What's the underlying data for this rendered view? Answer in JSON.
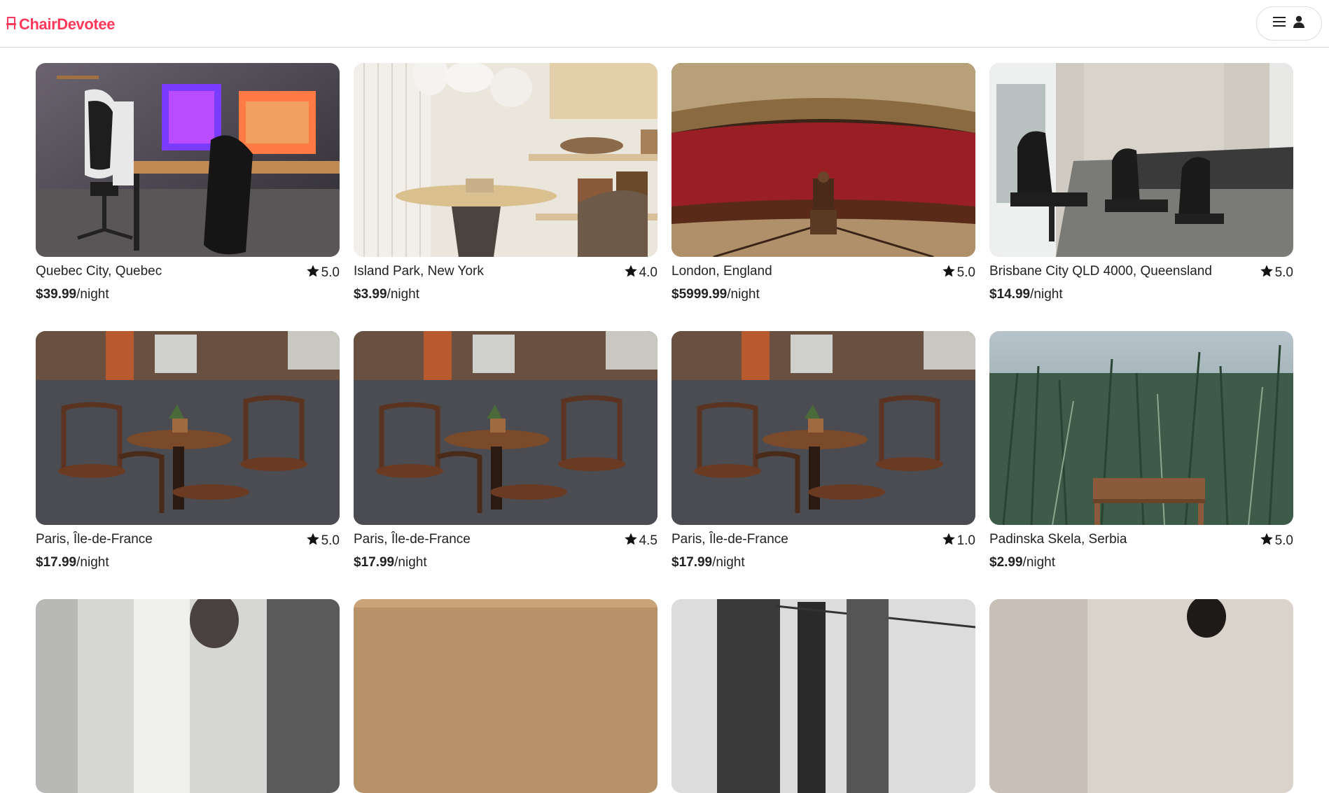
{
  "brand": {
    "name": "ChairDevotee",
    "color": "#ff385c",
    "icon": "chair-icon"
  },
  "header": {
    "menu_icon": "hamburger-icon",
    "user_icon": "user-icon"
  },
  "listings": [
    {
      "location": "Quebec City, Quebec",
      "rating": "5.0",
      "price": "$39.99",
      "unit": "/night",
      "image": "gaming-office-chair"
    },
    {
      "location": "Island Park, New York",
      "rating": "4.0",
      "price": "$3.99",
      "unit": "/night",
      "image": "round-table-room"
    },
    {
      "location": "London, England",
      "rating": "5.0",
      "price": "$5999.99",
      "unit": "/night",
      "image": "throne-hall"
    },
    {
      "location": "Brisbane City QLD 4000, Queensland",
      "rating": "5.0",
      "price": "$14.99",
      "unit": "/night",
      "image": "conference-chairs"
    },
    {
      "location": "Paris, Île-de-France",
      "rating": "5.0",
      "price": "$17.99",
      "unit": "/night",
      "image": "cafe-chairs"
    },
    {
      "location": "Paris, Île-de-France",
      "rating": "4.5",
      "price": "$17.99",
      "unit": "/night",
      "image": "cafe-chairs"
    },
    {
      "location": "Paris, Île-de-France",
      "rating": "1.0",
      "price": "$17.99",
      "unit": "/night",
      "image": "cafe-chairs"
    },
    {
      "location": "Padinska Skela, Serbia",
      "rating": "5.0",
      "price": "$2.99",
      "unit": "/night",
      "image": "chair-in-wheat-field"
    },
    {
      "location": "",
      "rating": "",
      "price": "",
      "unit": "",
      "image": "window-portrait"
    },
    {
      "location": "",
      "rating": "",
      "price": "",
      "unit": "",
      "image": "wood-wall"
    },
    {
      "location": "",
      "rating": "",
      "price": "",
      "unit": "",
      "image": "bridge-bw"
    },
    {
      "location": "",
      "rating": "",
      "price": "",
      "unit": "",
      "image": "person-portrait"
    }
  ]
}
